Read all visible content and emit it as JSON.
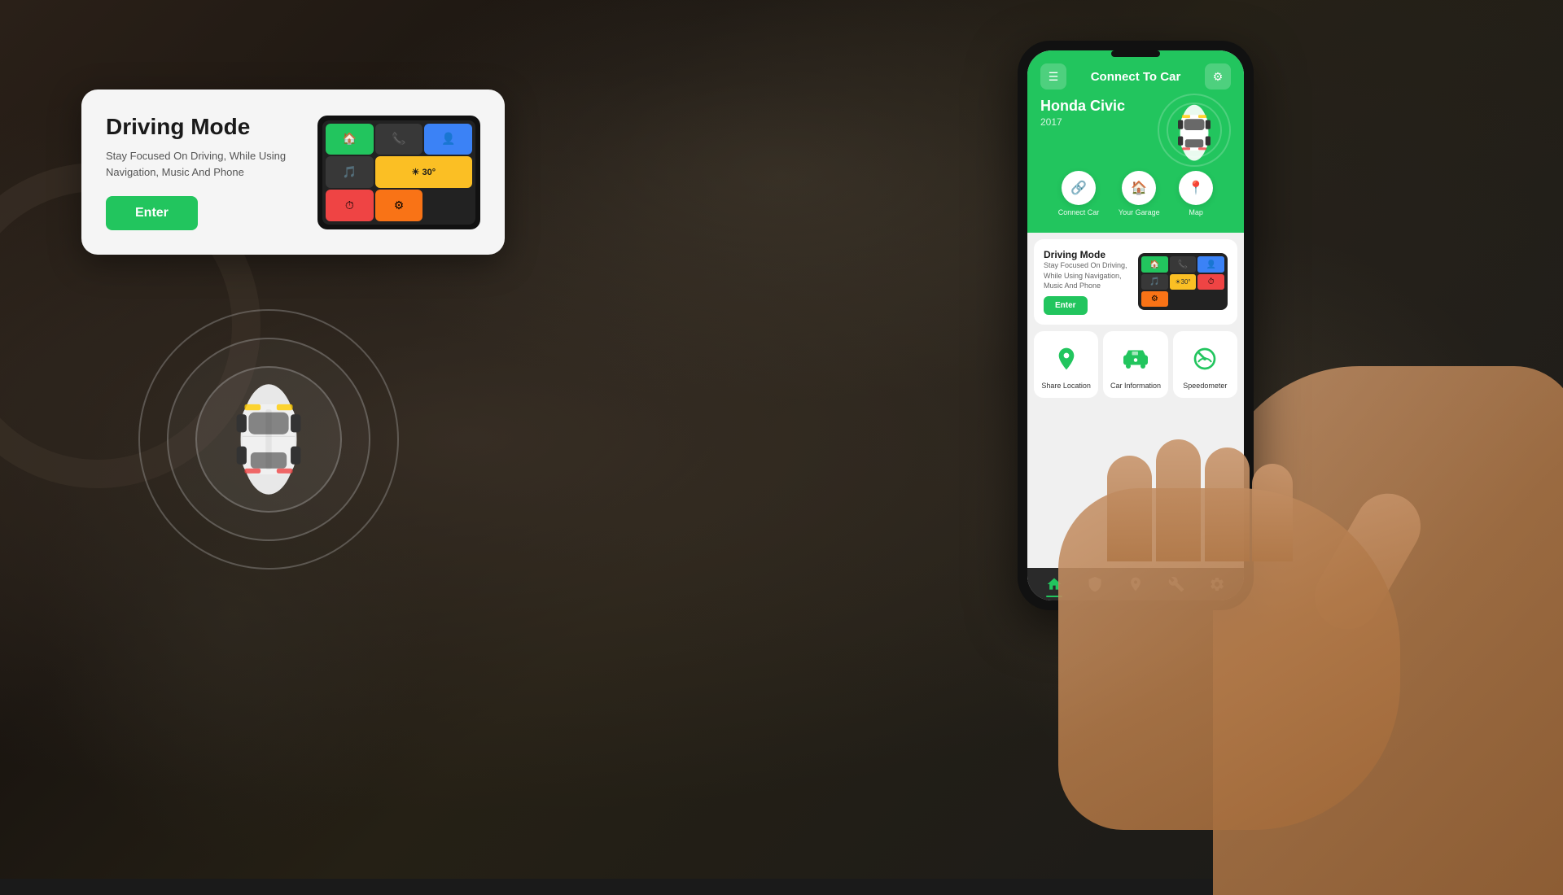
{
  "background": {
    "color": "#1a1510"
  },
  "driving_mode_card": {
    "title": "Driving Mode",
    "description": "Stay Focused On Driving, While Using Navigation, Music And Phone",
    "enter_button_label": "Enter"
  },
  "phone_app": {
    "header": {
      "menu_icon": "☰",
      "settings_icon": "⚙",
      "title": "Connect To Car",
      "car_name": "Honda Civic",
      "car_year": "2017"
    },
    "quick_actions": [
      {
        "icon": "🔗",
        "label": "Connect Car"
      },
      {
        "icon": "🏠",
        "label": "Your Garage"
      },
      {
        "icon": "📍",
        "label": "Map"
      }
    ],
    "driving_section": {
      "title": "Driving Mode",
      "description": "Stay Focused On Driving, While Using Navigation, Music And Phone",
      "enter_label": "Enter"
    },
    "grid_items": [
      {
        "label": "Share Location",
        "icon": "📍"
      },
      {
        "label": "Car Information",
        "icon": "🚗"
      },
      {
        "label": "Speedometer",
        "icon": "⏱"
      }
    ],
    "bottom_nav": [
      {
        "icon": "🏠",
        "active": true
      },
      {
        "icon": "🛡",
        "active": false
      },
      {
        "icon": "📍",
        "active": false
      },
      {
        "icon": "🔧",
        "active": false
      },
      {
        "icon": "⚙",
        "active": false
      }
    ]
  },
  "colors": {
    "primary": "#22c55e",
    "dark": "#1a1a1a",
    "card_bg": "#f5f5f5",
    "white": "#ffffff"
  }
}
